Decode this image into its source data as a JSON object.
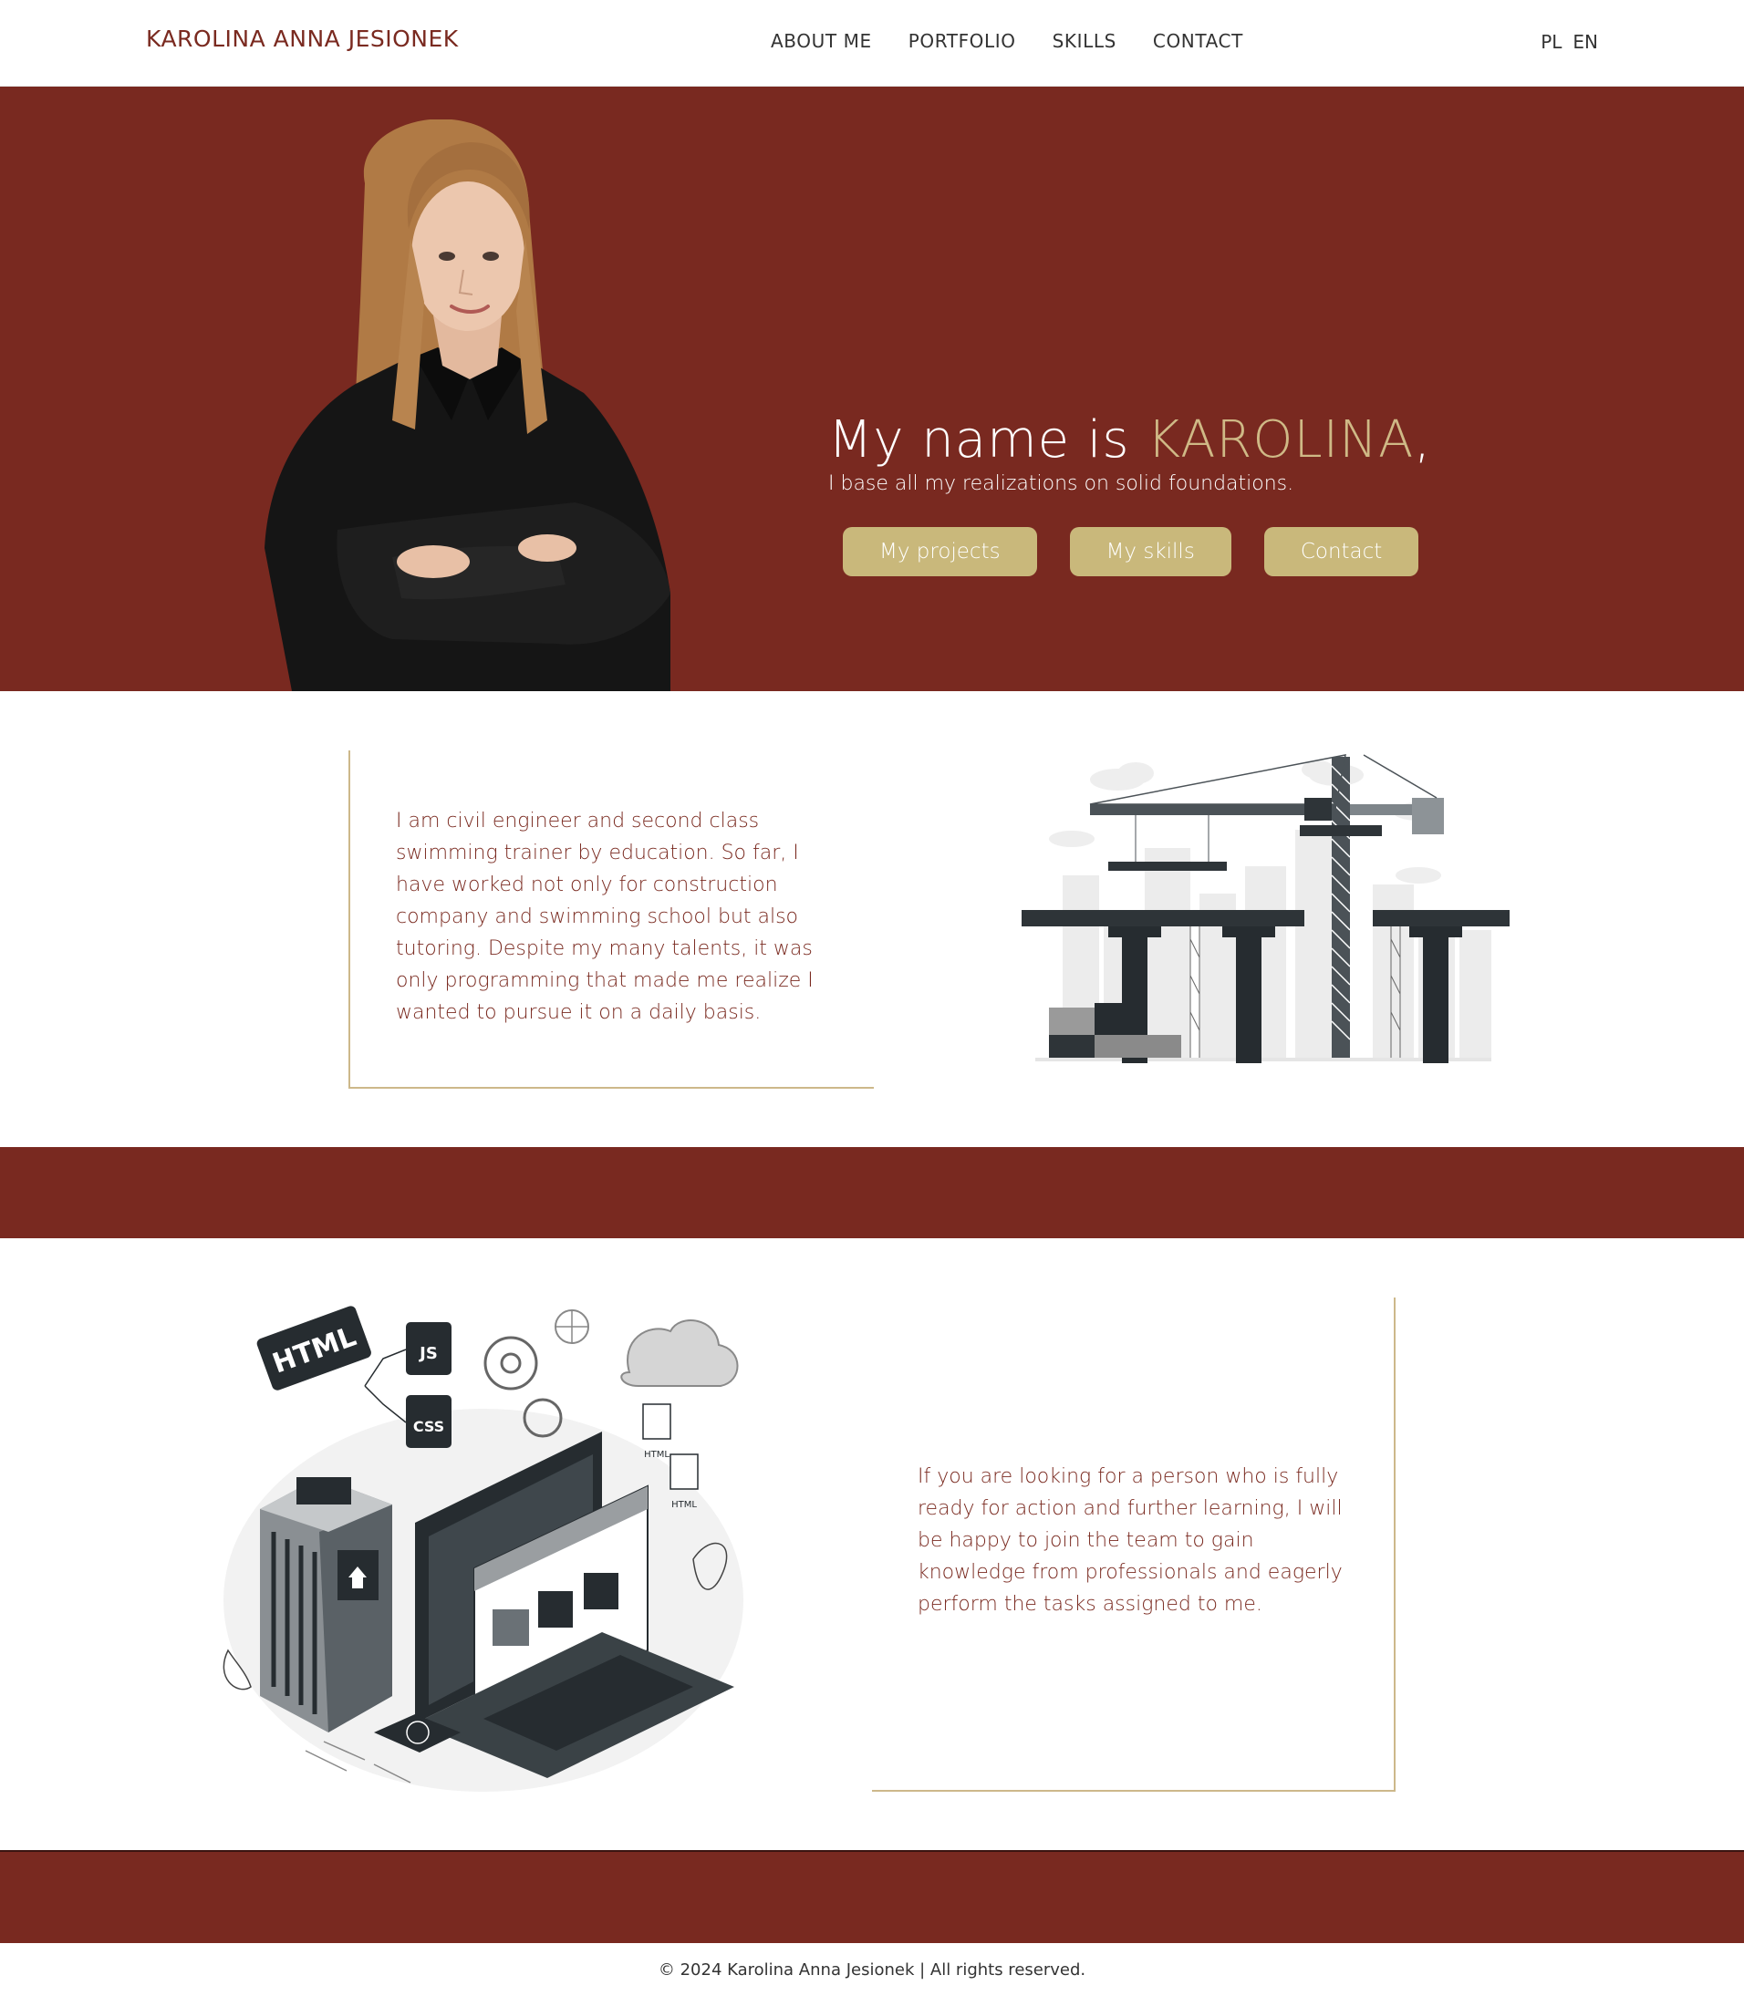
{
  "nav": {
    "brand": "KAROLINA ANNA JESIONEK",
    "links": [
      "ABOUT ME",
      "PORTFOLIO",
      "SKILLS",
      "CONTACT"
    ],
    "languages": [
      "PL",
      "EN"
    ]
  },
  "hero": {
    "title_prefix": "My name is ",
    "title_name": "KAROLINA",
    "title_suffix": ",",
    "subtitle": "I base all my realizations on solid foundations.",
    "buttons": [
      "My projects",
      "My skills",
      "Contact"
    ]
  },
  "about": {
    "text": "I am civil engineer and second class swimming trainer by education. So far, I have worked not only for construction company and swimming school but also tutoring. Despite my many talents, it was only programming that made me realize I wanted to pursue it on a daily basis."
  },
  "join": {
    "text": "If you are looking for a person who is fully ready for action and further learning, I will be happy to join the team to gain knowledge from professionals and eagerly perform the tasks assigned to me."
  },
  "illustration": {
    "labels": [
      "HTML",
      "JS",
      "CSS",
      "HTML",
      "HTML"
    ]
  },
  "footer": {
    "text": "© 2024 Karolina Anna Jesionek | All rights reserved."
  },
  "colors": {
    "maroon": "#792920",
    "gold": "#c9b87b",
    "accent_text": "#cfb986"
  }
}
